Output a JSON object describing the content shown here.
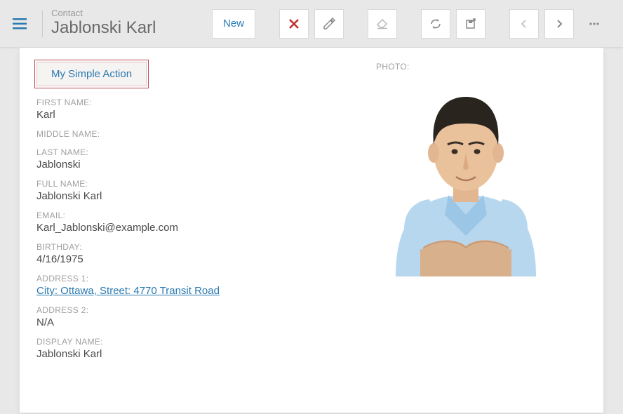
{
  "header": {
    "caption": "Contact",
    "title": "Jablonski Karl",
    "new_label": "New"
  },
  "action_button": "My Simple Action",
  "photo_label": "PHOTO:",
  "fields": {
    "first_name_label": "FIRST NAME:",
    "first_name_value": "Karl",
    "middle_name_label": "MIDDLE NAME:",
    "middle_name_value": "",
    "last_name_label": "LAST NAME:",
    "last_name_value": "Jablonski",
    "full_name_label": "FULL NAME:",
    "full_name_value": "Jablonski Karl",
    "email_label": "EMAIL:",
    "email_value": "Karl_Jablonski@example.com",
    "birthday_label": "BIRTHDAY:",
    "birthday_value": "4/16/1975",
    "address1_label": "ADDRESS 1:",
    "address1_value": "City: Ottawa, Street: 4770 Transit Road",
    "address2_label": "ADDRESS 2:",
    "address2_value": "N/A",
    "display_name_label": "DISPLAY NAME:",
    "display_name_value": "Jablonski Karl"
  }
}
